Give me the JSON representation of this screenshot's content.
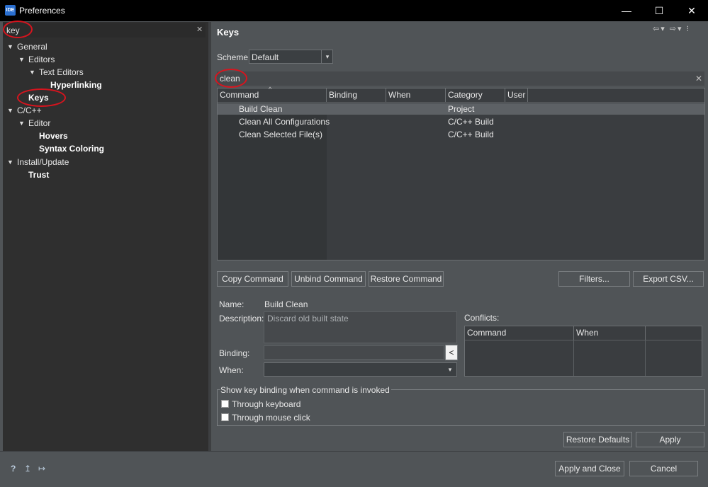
{
  "window": {
    "title": "Preferences",
    "app_icon": "IDE"
  },
  "titlebar_buttons": {
    "minimize": "—",
    "maximize": "☐",
    "close": "✕"
  },
  "filter": {
    "value": "key",
    "clear": "✕"
  },
  "tree": {
    "general": "General",
    "editors": "Editors",
    "text_editors": "Text Editors",
    "hyperlinking": "Hyperlinking",
    "keys": "Keys",
    "cpp": "C/C++",
    "editor": "Editor",
    "hovers": "Hovers",
    "syntax_coloring": "Syntax Coloring",
    "install_update": "Install/Update",
    "trust": "Trust"
  },
  "page": {
    "title": "Keys"
  },
  "scheme": {
    "label": "Scheme:",
    "value": "Default"
  },
  "search": {
    "value": "clean",
    "clear": "✕"
  },
  "table": {
    "headers": [
      "Command",
      "Binding",
      "When",
      "Category",
      "User"
    ],
    "rows": [
      {
        "command": "Build Clean",
        "binding": "",
        "when": "",
        "category": "Project",
        "user": ""
      },
      {
        "command": "Clean All Configurations",
        "binding": "",
        "when": "",
        "category": "C/C++ Build",
        "user": ""
      },
      {
        "command": "Clean Selected File(s)",
        "binding": "",
        "when": "",
        "category": "C/C++ Build",
        "user": ""
      }
    ]
  },
  "buttons": {
    "copy_command": "Copy Command",
    "unbind_command": "Unbind Command",
    "restore_command": "Restore Command",
    "filters": "Filters...",
    "export_csv": "Export CSV...",
    "restore_defaults": "Restore Defaults",
    "apply": "Apply",
    "apply_and_close": "Apply and Close",
    "cancel": "Cancel"
  },
  "details": {
    "name_label": "Name:",
    "name_value": "Build Clean",
    "description_label": "Description:",
    "description_value": "Discard old built state",
    "binding_label": "Binding:",
    "when_label": "When:"
  },
  "conflicts": {
    "label": "Conflicts:",
    "headers": [
      "Command",
      "When"
    ]
  },
  "show_binding": {
    "title": "Show key binding when command is invoked",
    "through_keyboard": "Through keyboard",
    "through_mouse": "Through mouse click"
  },
  "icons": {
    "help": "?",
    "import": "↥",
    "export": "↦",
    "back": "⇦",
    "forward": "⇨",
    "dropdown": "▾"
  },
  "colors": {
    "highlight_circle": "#d7141e",
    "background": "#505457",
    "tree_background": "#2f2f2f"
  }
}
